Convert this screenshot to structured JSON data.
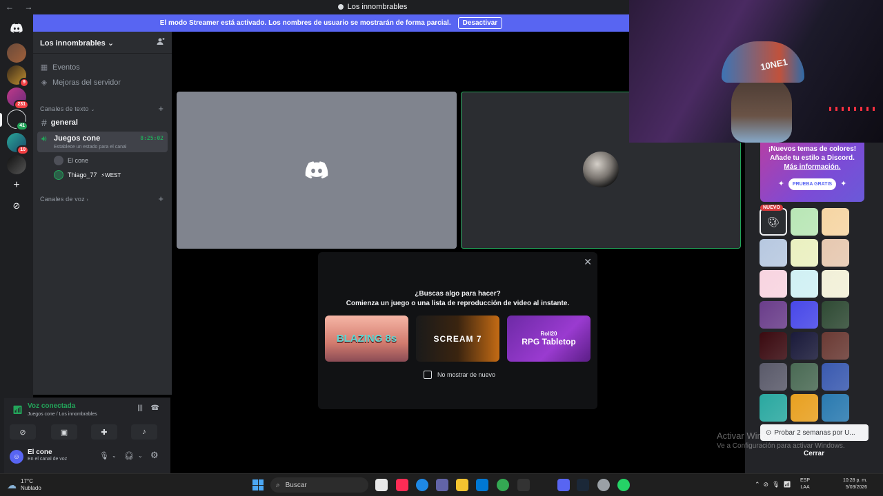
{
  "window": {
    "title": "Los innombrables",
    "nav_icons": "← →"
  },
  "banner": {
    "text": "El modo Streamer está activado. Los nombres de usuario se mostrarán de forma parcial.",
    "button": "Desactivar"
  },
  "rail": {
    "servers": [
      {
        "badge": ""
      },
      {
        "badge": "9"
      },
      {
        "badge": "231"
      },
      {
        "badge": "41"
      },
      {
        "badge": "10"
      },
      {
        "badge": ""
      }
    ]
  },
  "server": {
    "name": "Los innombrables",
    "chevron": "⌄",
    "events": "Eventos",
    "boosts": "Mejoras del servidor",
    "text_category": "Canales de texto",
    "voice_category": "Canales de voz",
    "text_channel": "general",
    "voice_channel": {
      "name": "Juegos cone",
      "timer": "8:25:02",
      "status": "Establece un estado para el canal"
    },
    "voice_users": [
      {
        "name": "El cone",
        "tag": ""
      },
      {
        "name": "Thiago_77",
        "tag": "⚡WEST"
      }
    ]
  },
  "voice_panel": {
    "title": "Voz conectada",
    "subtitle": "Juegos cone / Los innombrables"
  },
  "user_panel": {
    "name": "El cone",
    "status": "En el canal de voz"
  },
  "activity": {
    "question": "¿Buscas algo para hacer?",
    "subtitle": "Comienza un juego o una lista de reproducción de video al instante.",
    "games": [
      {
        "title": "BLAZING 8s"
      },
      {
        "title": "SCREAM 7"
      },
      {
        "studio": "Roll20",
        "title": "RPG Tabletop"
      }
    ],
    "checkbox_label": "No mostrar de nuevo"
  },
  "webcam": {
    "cap_text": "10NE1"
  },
  "themes": {
    "promo_line1": "¡Nuevos temas de colores!",
    "promo_line2": "Añade tu estilo a Discord.",
    "promo_link": "Más información.",
    "try_free": "PRUEBA GRATIS",
    "new_badge": "NUEVO",
    "swatches": [
      "#2b2d31",
      "#b8e6b5",
      "#f6d5a3",
      "#b7c8e0",
      "#eaf0c0",
      "#e6c8b0",
      "#f8d4e0",
      "#d0f0f4",
      "#f2f0d8",
      "#6a3d8a",
      "#4848e8",
      "#2f4a34",
      "#3a0a10",
      "#1a1a3a",
      "#6a3a34",
      "#5a5a6a",
      "#4a6a54",
      "#3a5ab0",
      "#2aa8a0",
      "#e8a020",
      "#2a7ab0"
    ],
    "trial_label": "Probar 2 semanas por U...",
    "close": "Cerrar"
  },
  "watermark": {
    "line1": "Activar Windows",
    "line2": "Ve a Configuración para activar Windows."
  },
  "taskbar": {
    "temp": "17°C",
    "weather": "Nublado",
    "search": "Buscar",
    "lang1": "ESP",
    "lang2": "LAA",
    "time": "10:28 p. m.",
    "date": "5/03/2026"
  }
}
